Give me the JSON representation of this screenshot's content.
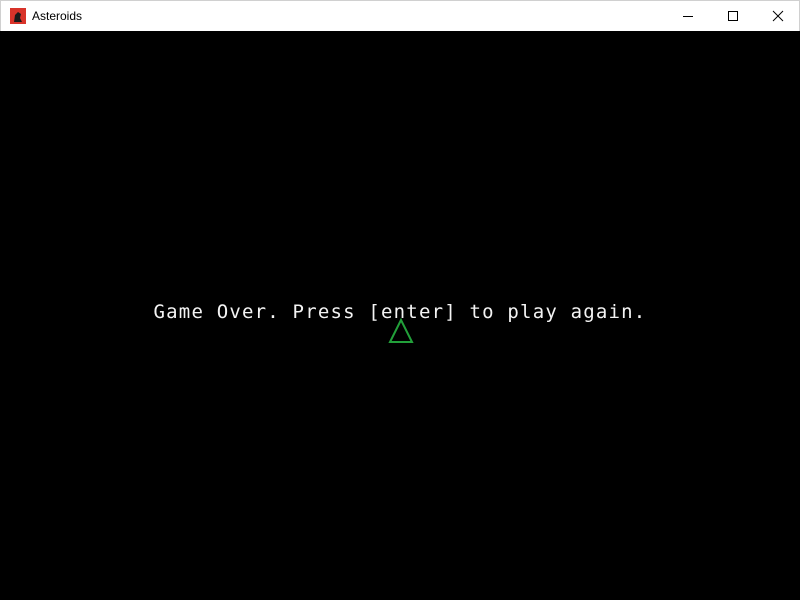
{
  "window": {
    "title": "Asteroids",
    "controls": [
      "minimize",
      "maximize",
      "close"
    ]
  },
  "game": {
    "message": "Game Over. Press [enter] to play again.",
    "ship": {
      "icon": "triangle-ship-icon",
      "color": "#22a03a"
    },
    "background_color": "#000000",
    "text_color": "#f4f4f4"
  }
}
